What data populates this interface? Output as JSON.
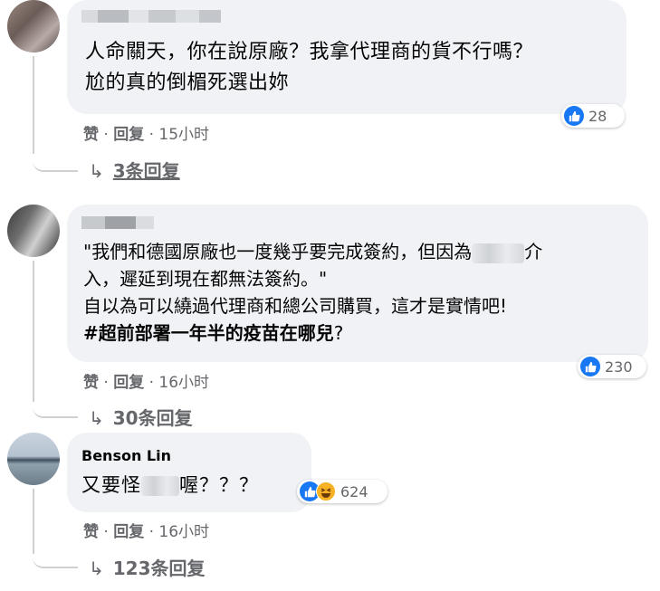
{
  "comments": [
    {
      "author": "",
      "lines": [
        "人命關天，你在說原廠？我拿代理商的貨不行嗎？",
        "尬的真的倒楣死選出妳"
      ],
      "actions": {
        "like": "赞",
        "dot": " · ",
        "reply": "回复",
        "time": " · 15小时"
      },
      "reaction_count": "28",
      "replies_label": "3条回复"
    },
    {
      "author": "",
      "line1_pre": "\"我們和德國原廠也一度幾乎要完成簽約，但因為",
      "line1_post": "介",
      "line2": "入，遲延到現在都無法簽約。\"",
      "line3": "自以為可以繞過代理商和總公司購買，這才是實情吧!",
      "line4_bold": "#超前部署一年半的疫苗在哪兒",
      "line4_end": "?",
      "actions": {
        "like": "赞",
        "dot": " · ",
        "reply": "回复",
        "time": " · 16小时"
      },
      "reaction_count": "230",
      "replies_label": "30条回复"
    },
    {
      "author": "Benson Lin",
      "text_pre": "又要怪",
      "text_post": "喔？？？",
      "actions": {
        "like": "赞",
        "dot": " · ",
        "reply": "回复",
        "time": " · 16小时"
      },
      "reaction_count": "624",
      "replies_label": "123条回复"
    }
  ],
  "colors": {
    "bubble": "#f0f2f5",
    "like_blue": "#1877f2",
    "haha_yellow": "#f7b125",
    "secondary": "#65676b"
  },
  "reply_arrow": "↳"
}
